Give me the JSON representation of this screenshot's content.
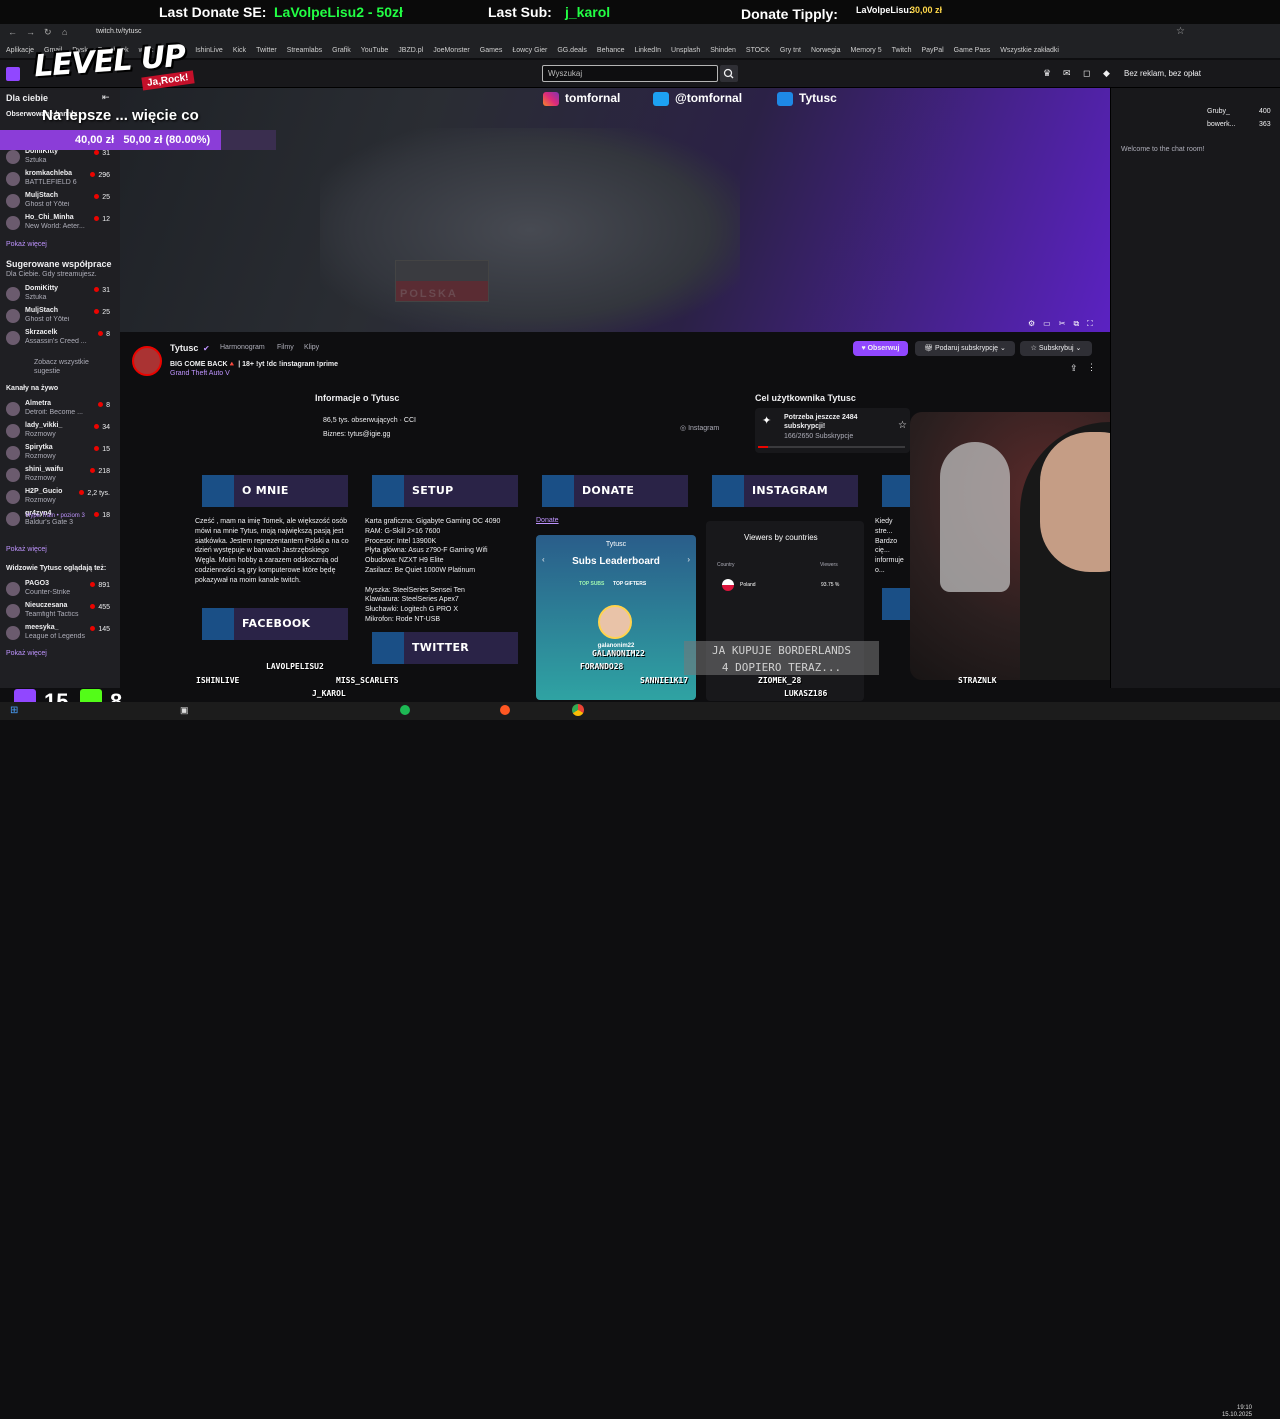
{
  "overlay": {
    "last_donate_label": "Last Donate SE:",
    "last_donate_value": "LaVolpeLisu2 - 50zł",
    "last_sub_label": "Last Sub:",
    "last_sub_value": "j_karol",
    "donate_tipply_label": "Donate Tipply:",
    "donate_tipply_name": "LaVolpeLisu:",
    "donate_tipply_value": "30,00 zł",
    "level_up": "LEVEL UP",
    "level_up_tag": "Ja,Rock!",
    "goal_title": "Na lepsze ... więcie co",
    "goal_current": "40,00 zł",
    "goal_progress_text": "50,00 zł (80.00%)",
    "goal_fraction": 0.8,
    "tts_line1": "JA KUPUJE BORDERLANDS",
    "tts_line2": "4 DOPIERO TERAZ...",
    "stat_a": "15",
    "stat_b": "8",
    "names": [
      "ISHINLIVE",
      "LAVOLPELISU2",
      "MISS_SCARLETS",
      "J_KAROL",
      "GALANONIM22",
      "FORANDO28",
      "SANNIE1K17",
      "ZIOMEK_28",
      "LUKASZ186",
      "STRAZNLK"
    ]
  },
  "browser": {
    "url": "twitch.tv/tytusc",
    "bookmarks": [
      "Aplikacje",
      "Gmail",
      "Dysk",
      "Facebook",
      "work",
      "Oculus",
      "IshinLive",
      "Kick",
      "Twitter",
      "Streamlabs",
      "Grafik",
      "YouTube",
      "JBZD.pl",
      "JoeMonster",
      "Games",
      "Łowcy Gier",
      "GG.deals",
      "Behance",
      "LinkedIn",
      "Unsplash",
      "Shinden",
      "STOCK",
      "Gry tnt",
      "Norwegia",
      "Memory 5",
      "Twitch",
      "PayPal",
      "Game Pass",
      "Wszystkie zakładki"
    ]
  },
  "nav": {
    "search_placeholder": "Wyszukaj",
    "ad_free": "Bez reklam, bez opłat"
  },
  "sidebar": {
    "for_you": "Dla ciebie",
    "following_head": "Obserwowane kanały",
    "following": [
      {
        "name": "DomiKitty",
        "game": "Sztuka",
        "viewers": "31"
      },
      {
        "name": "kromkachleba",
        "game": "BATTLEFIELD 6",
        "viewers": "296"
      },
      {
        "name": "MuljStach",
        "game": "Ghost of Yōtei",
        "viewers": "25"
      },
      {
        "name": "Ho_Chi_Minha",
        "game": "New World: Aeter...",
        "viewers": "12"
      }
    ],
    "show_more": "Pokaż więcej",
    "suggested_head": "Sugerowane współprace",
    "suggested_sub": "Dla Ciebie. Gdy streamujesz.",
    "suggested": [
      {
        "name": "DomiKitty",
        "game": "Sztuka",
        "viewers": "31"
      },
      {
        "name": "MuljStach",
        "game": "Ghost of Yōtei",
        "viewers": "25"
      },
      {
        "name": "Skrzacelk",
        "game": "Assassin's Creed ...",
        "viewers": "8"
      }
    ],
    "see_all": "Zobacz wszystkie sugestie",
    "live_head": "Kanały na żywo",
    "live": [
      {
        "name": "Almetra",
        "game": "Detroit: Become ...",
        "viewers": "8"
      },
      {
        "name": "lady_vikki_",
        "game": "Rozmowy",
        "viewers": "34"
      },
      {
        "name": "Spirytka",
        "game": "Rozmowy",
        "viewers": "15"
      },
      {
        "name": "shini_waifu",
        "game": "Rozmowy",
        "viewers": "218"
      },
      {
        "name": "H2P_Gucio",
        "game": "Rozmowy",
        "viewers": "2,2 tys."
      },
      {
        "name": "gr4zyn4",
        "game": "Baldur's Gate 3",
        "viewers": "18"
      }
    ],
    "hype_train": "Hype Train • poziom 3",
    "also_head": "Widzowie Tytusc oglądają też:",
    "also": [
      {
        "name": "PAGO3",
        "game": "Counter-Strike",
        "viewers": "891"
      },
      {
        "name": "Nieuczesana",
        "game": "Teamfight Tactics",
        "viewers": "455"
      },
      {
        "name": "meesyka_",
        "game": "League of Legends",
        "viewers": "145"
      }
    ]
  },
  "player": {
    "social": [
      "tomfornal",
      "@tomfornal",
      "Tytusc"
    ],
    "flag_text": "POLSKA"
  },
  "channel": {
    "name": "Tytusc",
    "tabs": [
      "Harmonogram",
      "Filmy",
      "Klipy"
    ],
    "title": "BIG COME BACK🔺 | 18+ !yt !dc !instagram !prime",
    "game": "Grand Theft Auto V",
    "follow": "Obserwuj",
    "gift": "Podaruj subskrypcję",
    "subscribe": "Subskrybuj"
  },
  "about": {
    "title": "Informacje o Tytusc",
    "followers": "86,5 tys. obserwujących · CCI",
    "business": "Biznes: tytus@igie.gg",
    "instagram": "Instagram",
    "goal_title": "Cel użytkownika Tytusc",
    "goal_text": "Potrzeba jeszcze 2484 subskrypcji!",
    "goal_count": "166/2650 Subskrypcje"
  },
  "panels": {
    "buttons": [
      "O MNIE",
      "SETUP",
      "DONATE",
      "INSTAGRAM",
      "FACEBOOK",
      "TWITTER"
    ],
    "about_text": "Cześć , mam na imię Tomek, ale większość osób mówi na mnie Tytus, moją największą pasją jest siatkówka. Jestem reprezentantem Polski a na co dzień występuje w barwach Jastrzębskiego Węgla. Moim hobby a zarazem odskocznią od codzienności są gry komputerowe które będę pokazywał na moim kanale twitch.",
    "setup_text": [
      "Karta graficzna: Gigabyte Gaming OC 4090",
      "RAM: G-Skill 2×16 7600",
      "Procesor: Intel 13900K",
      "Płyta główna: Asus z790-F Gaming Wifi",
      "Obudowa: NZXT H9 Elite",
      "Zasilacz: Be Quiet 1000W Platinum",
      "",
      "Myszka: SteelSeries Sensei Ten",
      "Klawiatura: SteelSeries Apex7",
      "Słuchawki: Logitech G PRO X",
      "Mikrofon: Rode NT-USB"
    ],
    "donate_link": "Donate",
    "leaderboard_user": "Tytusc",
    "leaderboard_title": "Subs Leaderboard",
    "top_subs": "TOP SUBS",
    "top_gifters": "TOP GIFTERS",
    "leader_1": "galanonim22",
    "viewers_title": "Viewers by countries",
    "country_label": "Country",
    "viewers_label": "Viewers",
    "country": "Poland",
    "country_pct": "93.75 %",
    "right_text": "Kiedy stre... Bardzo cię... informuje o... Wszystko... meczami, ... albo mam..."
  },
  "chat": {
    "welcome": "Welcome to the chat room!",
    "users": [
      {
        "name": "Gruby_",
        "count": "400"
      },
      {
        "name": "bowerk...",
        "count": "363"
      }
    ]
  },
  "taskbar": {
    "time": "19:10",
    "date": "15.10.2025"
  },
  "colors": {
    "twitch_purple": "#9147ff",
    "overlay_green": "#22ff44",
    "live_red": "#eb0400"
  }
}
